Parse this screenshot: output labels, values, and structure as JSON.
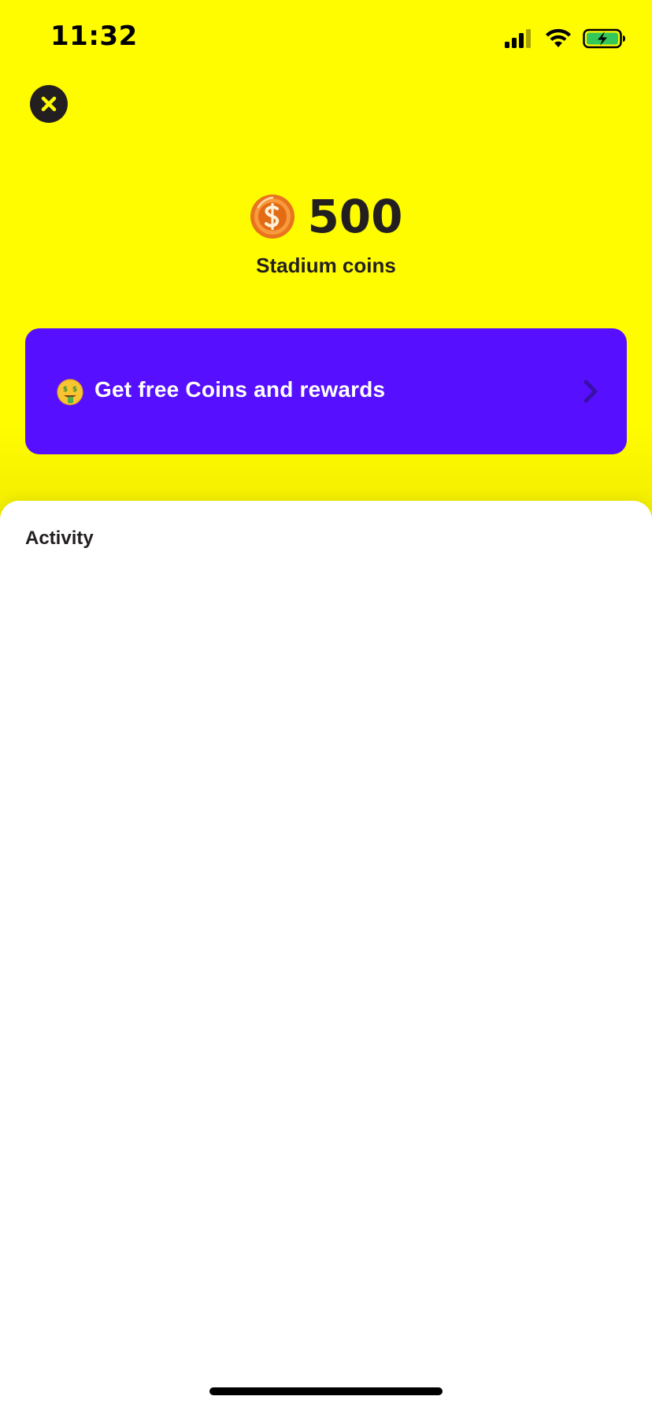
{
  "status_bar": {
    "time": "11:32"
  },
  "header": {
    "close_icon": "close-icon"
  },
  "balance": {
    "amount": "500",
    "caption": "Stadium coins",
    "coin_icon": "coin-icon"
  },
  "cta": {
    "label": "Get free Coins and rewards",
    "emoji_icon": "money-mouth-face-icon",
    "chevron_icon": "chevron-right-icon"
  },
  "activity": {
    "title": "Activity"
  },
  "colors": {
    "background_yellow": "#FFFC00",
    "cta_purple": "#560FFF",
    "dark_text": "#231F20",
    "sheet_white": "#FFFFFF",
    "battery_green": "#34C759"
  }
}
